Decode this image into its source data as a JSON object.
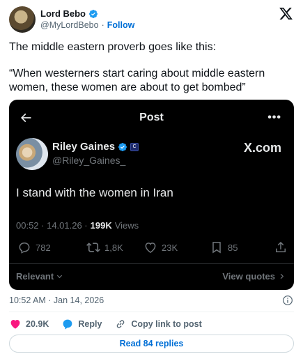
{
  "author": {
    "name": "Lord Bebo",
    "handle": "@MyLordBebo",
    "separator": "·",
    "follow_label": "Follow"
  },
  "tweet": {
    "line1": "The middle eastern proverb goes like this:",
    "line2": "“When westerners start caring about middle eastern women, these women are about to get bombed”"
  },
  "embedded": {
    "header_title": "Post",
    "more_label": "•••",
    "author_name": "Riley Gaines",
    "badge_text": "C",
    "author_handle": "@Riley_Gaines_",
    "watermark": "X.com",
    "text": "I stand with the women in Iran",
    "meta_time": "00:52 · 14.01.26 ·",
    "meta_views_count": "199K",
    "meta_views_label": "Views",
    "replies": "782",
    "reposts": "1,8K",
    "likes": "23K",
    "bookmarks": "85",
    "relevant_label": "Relevant",
    "view_quotes_label": "View quotes"
  },
  "footer": {
    "timestamp": "10:52 AM · Jan 14, 2026",
    "likes": "20.9K",
    "reply_label": "Reply",
    "copy_link_label": "Copy link to post",
    "read_replies_label": "Read 84 replies"
  },
  "colors": {
    "verified": "#1d9bf0",
    "like": "#f91880",
    "link": "#006fd6",
    "media_bg": "#000000"
  }
}
